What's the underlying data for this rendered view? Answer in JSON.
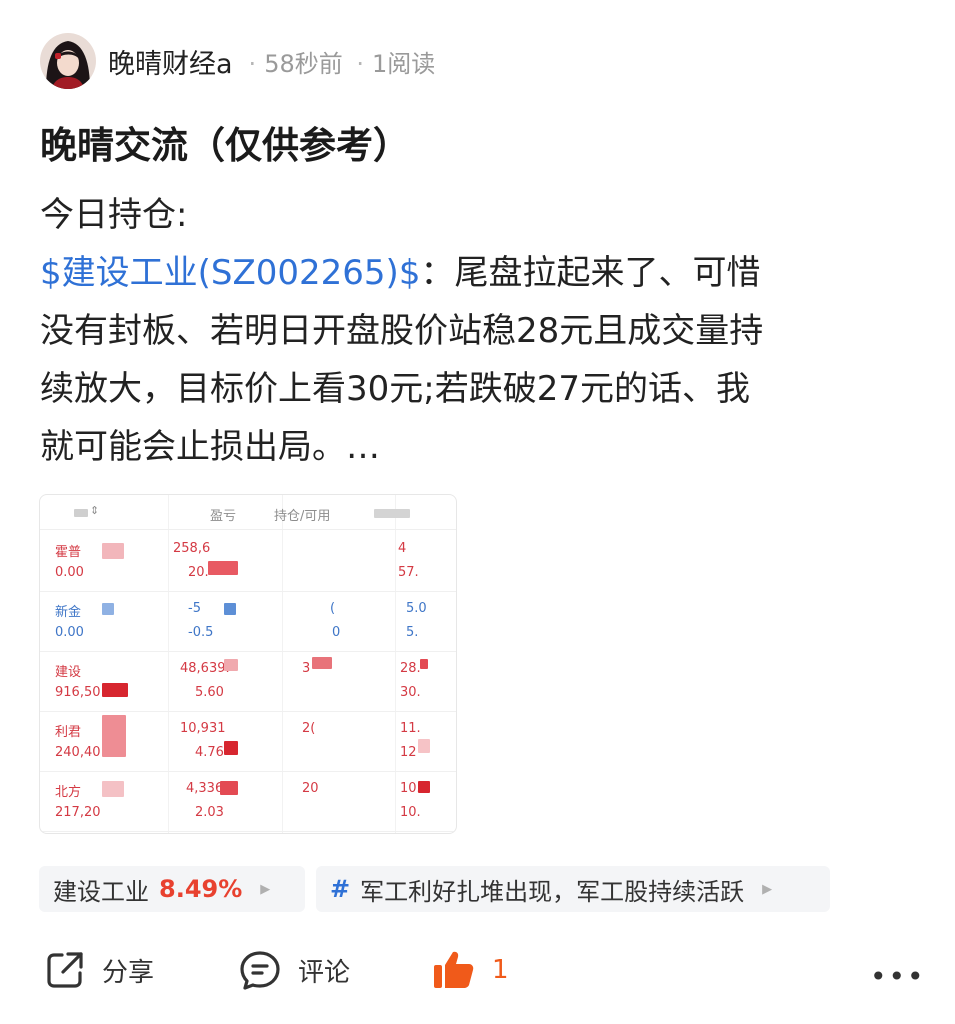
{
  "post": {
    "author": "晚晴财经a",
    "time": "58秒前",
    "reads": "1阅读",
    "title": "晚晴交流（仅供参考）",
    "line1": "今日持仓:",
    "stock_link": "$建设工业(SZ002265)$",
    "line2_rest": "：尾盘拉起来了、可惜",
    "line3": "没有封板、若明日开盘股价站稳28元且成交量持",
    "line4": "续放大，目标价上看30元;若跌破27元的话、我",
    "line5": "就可能会止损出局。…"
  },
  "holdings": {
    "headers": [
      "盈亏",
      "持仓/可用"
    ],
    "rows": [
      {
        "name": "霍普",
        "sub": "0.00",
        "pnl": "258,6",
        "pct": "20.",
        "pos": "",
        "pos2": "",
        "p1": "4",
        "p2": "57.",
        "trend": "up"
      },
      {
        "name": "新金",
        "sub": "0.00",
        "pnl": "-5",
        "pct": "-0.5",
        "pos": "(",
        "pos2": "0",
        "p1": "5.0",
        "p2": "5.",
        "trend": "down"
      },
      {
        "name": "建设",
        "sub": "916,50",
        "pnl": "48,639.",
        "pct": "5.60",
        "pos": "3",
        "pos2": "",
        "p1": "28.",
        "p2": "30.",
        "trend": "up"
      },
      {
        "name": "利君",
        "sub": "240,40",
        "pnl": "10,931",
        "pct": "4.76",
        "pos": "2(",
        "pos2": "",
        "p1": "11.",
        "p2": "12",
        "trend": "up"
      },
      {
        "name": "北方",
        "sub": "217,20",
        "pnl": "4,336",
        "pct": "2.03",
        "pos": "20",
        "pos2": "",
        "p1": "10.",
        "p2": "10.",
        "trend": "up"
      }
    ]
  },
  "tags": {
    "stock_name": "建设工业",
    "stock_change": "8.49%",
    "topic_icon": "#",
    "topic": "军工利好扎堆出现，军工股持续活跃"
  },
  "actions": {
    "share": "分享",
    "comment": "评论",
    "like_count": "1",
    "more": "•••"
  },
  "colors": {
    "link": "#2f71d6",
    "up": "#e8412f",
    "like": "#f05a1a"
  }
}
